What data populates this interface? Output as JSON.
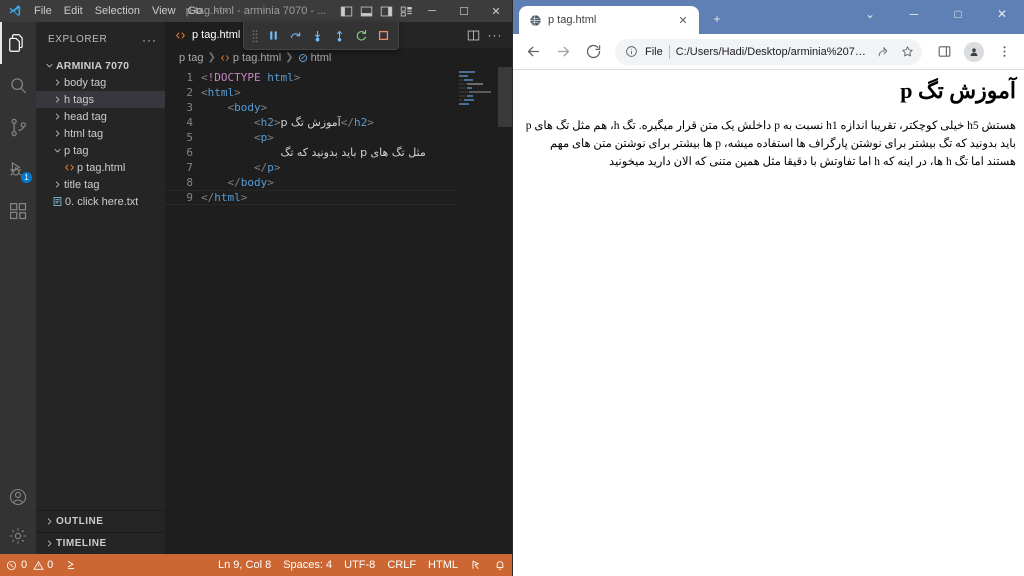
{
  "vscode": {
    "titlebar": {
      "menus": [
        "File",
        "Edit",
        "Selection",
        "View",
        "Go"
      ],
      "more": "···",
      "window_title": "p tag.html - arminia 7070 - ...",
      "layout_icons": [
        "panel-left-icon",
        "panel-bottom-icon",
        "panel-right-icon",
        "customize-layout-icon"
      ],
      "minimize": "─",
      "maximize": "☐",
      "close": "✕"
    },
    "activitybar": {
      "items": [
        {
          "name": "explorer",
          "icon": "files-icon",
          "active": true,
          "badge": ""
        },
        {
          "name": "search",
          "icon": "search-icon",
          "active": false,
          "badge": ""
        },
        {
          "name": "source-control",
          "icon": "source-control-icon",
          "active": false,
          "badge": ""
        },
        {
          "name": "run-and-debug",
          "icon": "run-debug-icon",
          "active": false,
          "badge": "1"
        },
        {
          "name": "extensions",
          "icon": "extensions-icon",
          "active": false,
          "badge": ""
        }
      ],
      "bottom": [
        {
          "name": "accounts",
          "icon": "account-icon"
        },
        {
          "name": "manage",
          "icon": "gear-icon"
        }
      ]
    },
    "sidebar": {
      "title": "EXPLORER",
      "more_actions": "···",
      "root": {
        "label": "ARMINIA 7070",
        "expanded": true
      },
      "tree": [
        {
          "label": "body tag",
          "type": "folder",
          "expanded": false,
          "selected": false,
          "depth": 1
        },
        {
          "label": "h tags",
          "type": "folder",
          "expanded": false,
          "selected": true,
          "depth": 1
        },
        {
          "label": "head tag",
          "type": "folder",
          "expanded": false,
          "selected": false,
          "depth": 1
        },
        {
          "label": "html tag",
          "type": "folder",
          "expanded": false,
          "selected": false,
          "depth": 1
        },
        {
          "label": "p tag",
          "type": "folder",
          "expanded": true,
          "selected": false,
          "depth": 1
        },
        {
          "label": "p tag.html",
          "type": "html-file",
          "expanded": false,
          "selected": false,
          "depth": 2
        },
        {
          "label": "title tag",
          "type": "folder",
          "expanded": false,
          "selected": false,
          "depth": 1
        },
        {
          "label": "0. click here.txt",
          "type": "text-file",
          "expanded": false,
          "selected": false,
          "depth": 1
        }
      ],
      "panels": [
        "OUTLINE",
        "TIMELINE"
      ]
    },
    "editor": {
      "tab_label": "p tag.html",
      "tab_actions": [
        "split-editor-icon",
        "more-actions-icon"
      ],
      "debug_toolbar": [
        "drag-handle-icon",
        "pause-icon",
        "step-over-icon",
        "step-into-icon",
        "step-out-icon",
        "restart-icon",
        "stop-icon"
      ],
      "breadcrumbs": [
        "p tag",
        "p tag.html",
        "html"
      ],
      "line_numbers": [
        "1",
        "2",
        "3",
        "4",
        "5",
        "6",
        "7",
        "8",
        "9"
      ],
      "code": [
        {
          "n": 1,
          "html": "<span class=\"br\">&lt;</span><span class=\"dockey\">!DOCTYPE</span> <span class=\"tg\">html</span><span class=\"br\">&gt;</span>"
        },
        {
          "n": 2,
          "html": "<span class=\"br\">&lt;</span><span class=\"tg\">html</span><span class=\"br\">&gt;</span>"
        },
        {
          "n": 3,
          "html": "    <span class=\"br\">&lt;</span><span class=\"tg\">body</span><span class=\"br\">&gt;</span>"
        },
        {
          "n": 4,
          "html": "        <span class=\"br\">&lt;</span><span class=\"tg\">h2</span><span class=\"br\">&gt;</span><span class=\"fa\">آموزش تگ p</span><span class=\"br\">&lt;/</span><span class=\"tg\">h2</span><span class=\"br\">&gt;</span>"
        },
        {
          "n": 5,
          "html": "        <span class=\"br\">&lt;</span><span class=\"tg\">p</span><span class=\"br\">&gt;</span>"
        },
        {
          "n": 6,
          "html": "            <span class=\"fa\">مثل تگ های p باید بدونید که تگ</span>"
        },
        {
          "n": 7,
          "html": "        <span class=\"br\">&lt;/</span><span class=\"tg\">p</span><span class=\"br\">&gt;</span>"
        },
        {
          "n": 8,
          "html": "    <span class=\"br\">&lt;/</span><span class=\"tg\">body</span><span class=\"br\">&gt;</span>"
        },
        {
          "n": 9,
          "html": "<span class=\"br\">&lt;/</span><span class=\"tg\">html</span><span class=\"br\">&gt;</span>"
        }
      ]
    },
    "statusbar": {
      "errors": "0",
      "warnings": "0",
      "remote_icon": "remote-window-icon",
      "position": "Ln 9, Col 8",
      "spaces": "Spaces: 4",
      "encoding": "UTF-8",
      "eol": "CRLF",
      "language": "HTML",
      "feedback_icon": "feedback-icon",
      "bell_icon": "bell-icon",
      "background": "#cc6633"
    }
  },
  "chrome": {
    "tab": {
      "title": "p tag.html",
      "favicon": "globe-icon",
      "close": "✕"
    },
    "new_tab": "+",
    "window": {
      "collapse": "⌄",
      "minimize": "─",
      "maximize": "□",
      "close": "✕"
    },
    "toolbar": {
      "back": "back-icon",
      "forward": "forward-icon",
      "reload": "reload-icon",
      "file_label": "File",
      "url": "C:/Users/Hadi/Desktop/arminia%207070/p%20tag...",
      "share_icon": "share-icon",
      "bookmark_icon": "star-icon",
      "sidepanel_icon": "side-panel-icon",
      "profile_icon": "profile-avatar-icon",
      "menu_icon": "three-dot-menu-icon"
    },
    "page": {
      "heading": "آموزش تگ p",
      "paragraph": "هستش h5 خیلی کوچکتر، تقریبا اندازه h1 نسبت به p داخلش یک متن قرار میگیره. تگ h، هم مثل تگ های p باید بدونید که تگ بیشتر برای نوشتن پارگراف ها استفاده میشه، p ها بیشتر برای نوشتن متن های مهم هستند اما تگ h ها، در اینه که h اما تفاوتش با دقیقا مثل همین متنی که الان دارید میخونید"
    }
  }
}
